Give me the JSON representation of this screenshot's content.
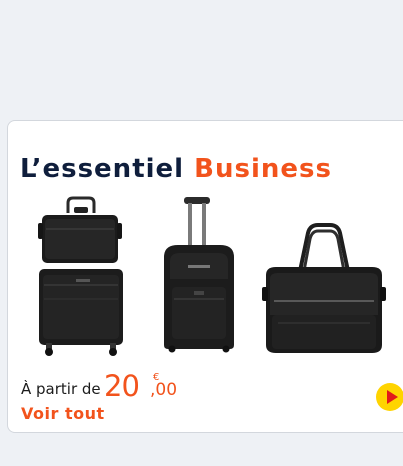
{
  "card": {
    "title_part1": "L’essentiel",
    "title_part2": "Business",
    "products": [
      {
        "name": "pilot-case-set-icon"
      },
      {
        "name": "rolling-backpack-icon"
      },
      {
        "name": "laptop-briefcase-icon"
      }
    ],
    "price": {
      "prefix": "À partir de",
      "integer": "20",
      "currency": "€",
      "decimals": ",00"
    },
    "see_all": "Voir tout",
    "next_icon": "play-arrow-icon"
  },
  "colors": {
    "accent": "#f2531c",
    "title_dark": "#0f1e3c",
    "next_button": "#ffd400",
    "next_arrow": "#e21a1a"
  }
}
